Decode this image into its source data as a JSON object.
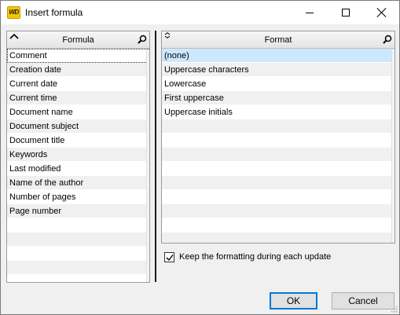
{
  "window": {
    "title": "Insert formula",
    "app_icon_text": "WD"
  },
  "formula_table": {
    "header": "Formula",
    "items": [
      "Comment",
      "Creation date",
      "Current date",
      "Current time",
      "Document name",
      "Document subject",
      "Document title",
      "Keywords",
      "Last modified",
      "Name of the author",
      "Number of pages",
      "Page number"
    ],
    "focused_index": 0
  },
  "format_table": {
    "header": "Format",
    "items": [
      "(none)",
      "Uppercase characters",
      "Lowercase",
      "First uppercase",
      "Uppercase initials"
    ],
    "selected_index": 0
  },
  "keep_formatting": {
    "label": "Keep the formatting during each update",
    "checked": true
  },
  "buttons": {
    "ok": "OK",
    "cancel": "Cancel"
  },
  "colors": {
    "selected_row": "#cce8ff",
    "alt_row": "#f0f0f0",
    "default_button_border": "#0078d7",
    "app_icon": "#f6c500"
  }
}
